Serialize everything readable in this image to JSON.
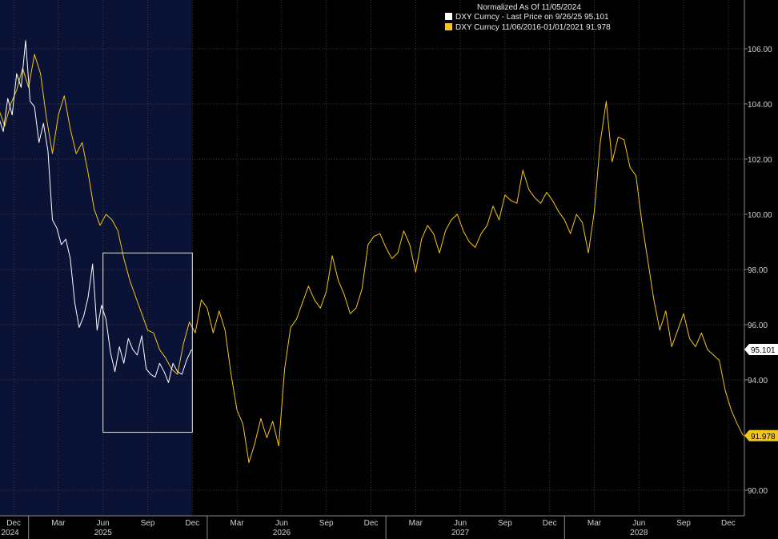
{
  "legend": {
    "title": "Normalized As Of 11/05/2024",
    "series1": "DXY Curncy - Last Price on 9/26/25 95.101",
    "series2": "DXY Curncy 11/06/2016-01/01/2021 91.978"
  },
  "colors": {
    "series1": "#ffffff",
    "series2": "#f5c518",
    "shade": "#0a1236",
    "grid": "#3a3a3a",
    "background": "#000000"
  },
  "chart_data": {
    "type": "line",
    "ylim": [
      89.0,
      107.0
    ],
    "yticks": [
      "106.00",
      "104.00",
      "102.00",
      "100.00",
      "98.00",
      "96.00",
      "94.00",
      "90.00"
    ],
    "ytick_values": [
      106,
      104,
      102,
      100,
      98,
      96,
      94,
      90
    ],
    "xlim": [
      0,
      50.5
    ],
    "xticks": [
      {
        "label": "Dec",
        "m": 1
      },
      {
        "label": "Mar",
        "m": 4
      },
      {
        "label": "Jun",
        "m": 7
      },
      {
        "label": "Sep",
        "m": 10
      },
      {
        "label": "Dec",
        "m": 13
      },
      {
        "label": "Mar",
        "m": 16
      },
      {
        "label": "Jun",
        "m": 19
      },
      {
        "label": "Sep",
        "m": 22
      },
      {
        "label": "Dec",
        "m": 25
      },
      {
        "label": "Mar",
        "m": 28
      },
      {
        "label": "Jun",
        "m": 31
      },
      {
        "label": "Sep",
        "m": 34
      },
      {
        "label": "Dec",
        "m": 37
      },
      {
        "label": "Mar",
        "m": 40
      },
      {
        "label": "Jun",
        "m": 43
      },
      {
        "label": "Sep",
        "m": 46
      },
      {
        "label": "Dec",
        "m": 49
      }
    ],
    "years": [
      {
        "label": "2024",
        "m": 0
      },
      {
        "label": "2025",
        "m": 7
      },
      {
        "label": "2026",
        "m": 19
      },
      {
        "label": "2027",
        "m": 31
      },
      {
        "label": "2028",
        "m": 43
      }
    ],
    "year_dividers": [
      2,
      14,
      26,
      38
    ],
    "shaded_until": 12.95,
    "box": {
      "x0": 7.0,
      "x1": 13.0,
      "y0": 92.1,
      "y1": 98.6
    },
    "series": [
      {
        "name": "DXY Curncy - Last Price on 9/26/25 95.101",
        "last_value": 95.101,
        "x": [
          0,
          0.3,
          0.6,
          0.9,
          1.2,
          1.5,
          1.8,
          2.1,
          2.4,
          2.7,
          3.0,
          3.3,
          3.6,
          3.9,
          4.2,
          4.5,
          4.8,
          5.1,
          5.4,
          5.7,
          6.0,
          6.3,
          6.6,
          6.9,
          7.2,
          7.5,
          7.8,
          8.1,
          8.4,
          8.7,
          9.0,
          9.3,
          9.6,
          9.9,
          10.2,
          10.5,
          10.8,
          11.1,
          11.4,
          11.7,
          12.0,
          12.3,
          12.6,
          12.95
        ],
        "y": [
          103.5,
          103.0,
          104.2,
          103.6,
          105.1,
          104.6,
          106.3,
          104.1,
          103.9,
          102.6,
          103.3,
          102.3,
          99.8,
          99.5,
          98.9,
          99.1,
          98.4,
          96.8,
          95.9,
          96.3,
          97.0,
          98.2,
          95.8,
          96.7,
          96.2,
          95.0,
          94.3,
          95.2,
          94.6,
          95.5,
          95.1,
          94.9,
          95.6,
          94.4,
          94.2,
          94.1,
          94.6,
          94.3,
          93.9,
          94.6,
          94.3,
          94.2,
          94.7,
          95.101
        ]
      },
      {
        "name": "DXY Curncy 11/06/2016-01/01/2021 91.978",
        "last_value": 91.978,
        "x": [
          0,
          0.4,
          0.8,
          1.2,
          1.6,
          2.0,
          2.4,
          2.8,
          3.2,
          3.6,
          4.0,
          4.4,
          4.8,
          5.2,
          5.6,
          6.0,
          6.4,
          6.8,
          7.2,
          7.6,
          8.0,
          8.4,
          8.8,
          9.2,
          9.6,
          10.0,
          10.4,
          10.8,
          11.2,
          11.6,
          12.0,
          12.4,
          12.8,
          13.2,
          13.6,
          14.0,
          14.4,
          14.8,
          15.2,
          15.6,
          16.0,
          16.4,
          16.8,
          17.2,
          17.6,
          18.0,
          18.4,
          18.8,
          19.2,
          19.6,
          20.0,
          20.4,
          20.8,
          21.2,
          21.6,
          22.0,
          22.4,
          22.8,
          23.2,
          23.6,
          24.0,
          24.4,
          24.8,
          25.2,
          25.6,
          26.0,
          26.4,
          26.8,
          27.2,
          27.6,
          28.0,
          28.4,
          28.8,
          29.2,
          29.6,
          30.0,
          30.4,
          30.8,
          31.2,
          31.6,
          32.0,
          32.4,
          32.8,
          33.2,
          33.6,
          34.0,
          34.4,
          34.8,
          35.2,
          35.6,
          36.0,
          36.4,
          36.8,
          37.2,
          37.6,
          38.0,
          38.4,
          38.8,
          39.2,
          39.6,
          40.0,
          40.4,
          40.8,
          41.2,
          41.6,
          42.0,
          42.4,
          42.8,
          43.2,
          43.6,
          44.0,
          44.4,
          44.8,
          45.2,
          45.6,
          46.0,
          46.4,
          46.8,
          47.2,
          47.6,
          48.0,
          48.4,
          48.8,
          49.2,
          49.6,
          50.0
        ],
        "y": [
          103.8,
          103.2,
          104.0,
          104.5,
          105.3,
          104.6,
          105.8,
          105.1,
          103.5,
          102.2,
          103.6,
          104.3,
          103.1,
          102.2,
          102.6,
          101.5,
          100.2,
          99.6,
          100.0,
          99.8,
          99.4,
          98.4,
          97.6,
          97.0,
          96.4,
          95.8,
          95.7,
          95.1,
          94.8,
          94.4,
          94.2,
          95.3,
          96.1,
          95.7,
          96.9,
          96.6,
          95.7,
          96.5,
          95.8,
          94.2,
          92.9,
          92.4,
          91.0,
          91.7,
          92.6,
          91.9,
          92.5,
          91.6,
          94.4,
          95.9,
          96.2,
          96.8,
          97.4,
          96.9,
          96.6,
          97.2,
          98.5,
          97.6,
          97.1,
          96.4,
          96.6,
          97.3,
          98.9,
          99.2,
          99.3,
          98.8,
          98.4,
          98.6,
          99.4,
          98.9,
          97.9,
          99.1,
          99.6,
          99.3,
          98.6,
          99.4,
          99.8,
          100.0,
          99.4,
          99.0,
          98.8,
          99.3,
          99.6,
          100.3,
          99.8,
          100.7,
          100.5,
          100.4,
          101.6,
          100.9,
          100.6,
          100.4,
          100.8,
          100.5,
          100.1,
          99.8,
          99.3,
          100.0,
          99.7,
          98.6,
          100.1,
          102.6,
          104.1,
          101.9,
          102.8,
          102.7,
          101.7,
          101.4,
          99.7,
          98.3,
          96.9,
          95.8,
          96.5,
          95.2,
          95.8,
          96.4,
          95.5,
          95.2,
          95.7,
          95.1,
          94.9,
          94.7,
          93.6,
          92.9,
          92.4,
          91.978
        ]
      }
    ]
  }
}
